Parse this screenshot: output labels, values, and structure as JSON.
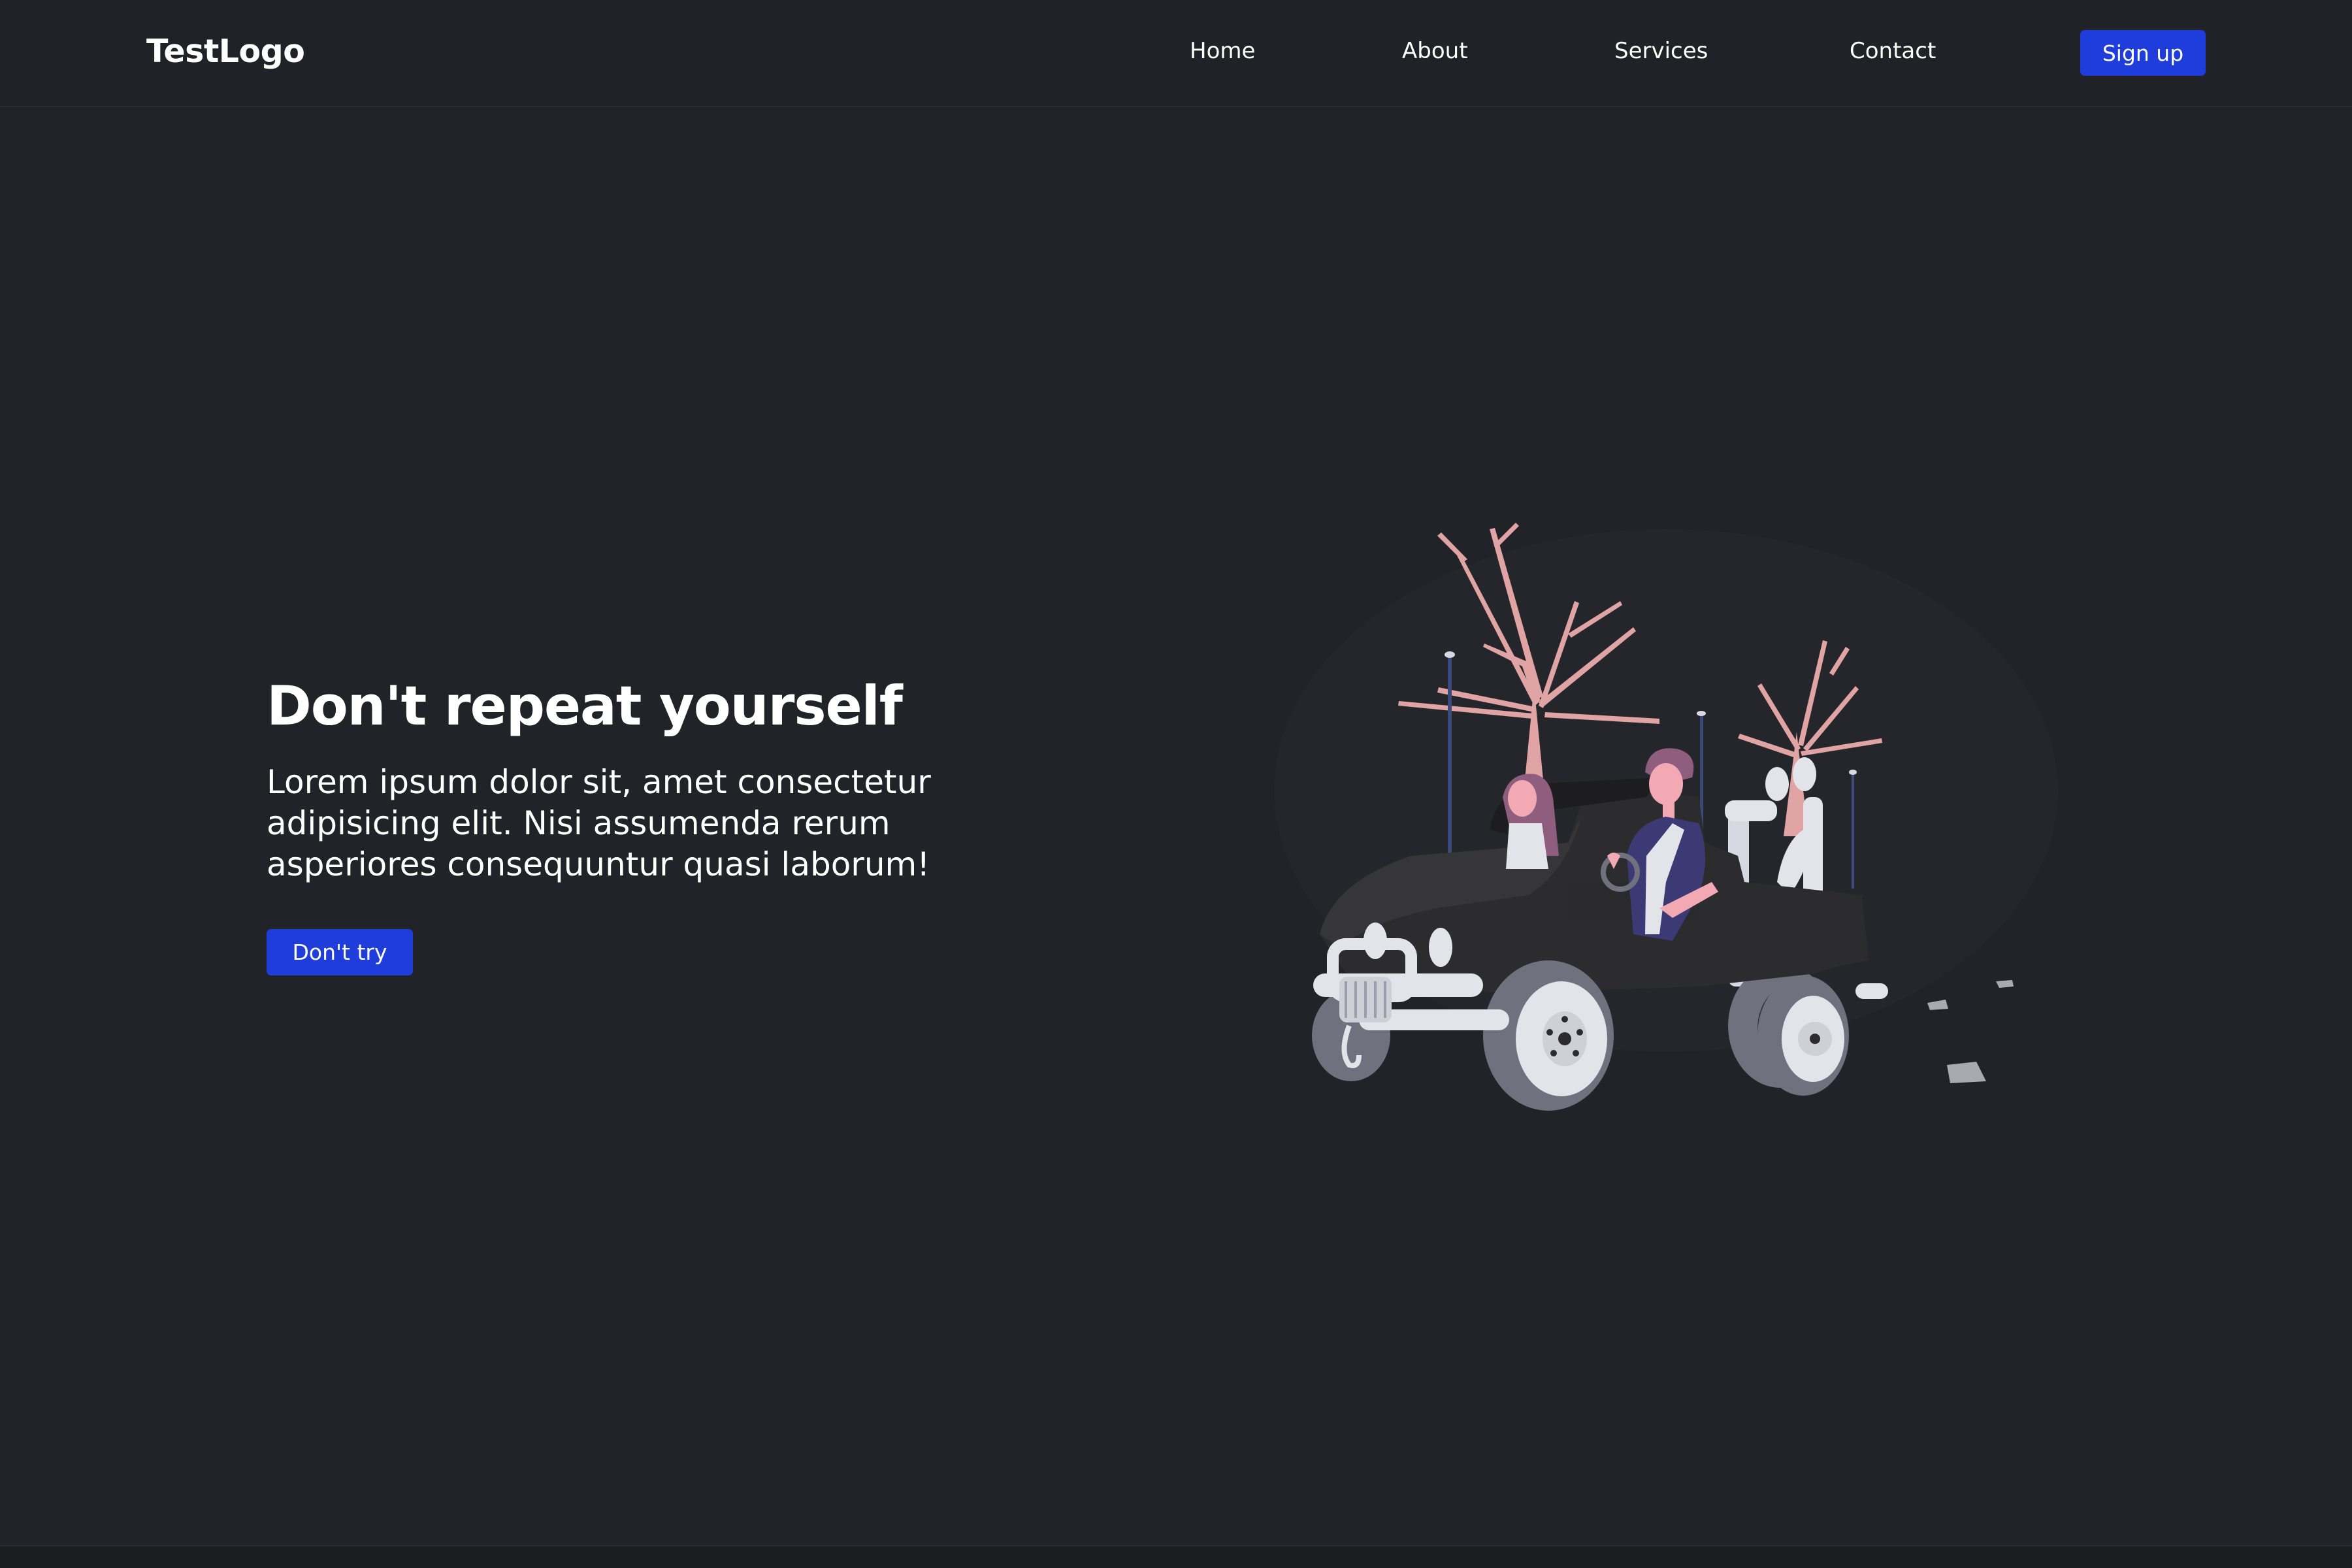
{
  "nav": {
    "logo": "TestLogo",
    "links": [
      "Home",
      "About",
      "Services",
      "Contact"
    ],
    "signup": "Sign up"
  },
  "hero": {
    "title": "Don't repeat yourself",
    "description_lines": [
      "Lorem ipsum dolor sit, amet consectetur",
      "adipisicing elit. Nisi assumenda rerum",
      "asperiores consequuntur quasi laborum!"
    ],
    "cta": "Don't try"
  },
  "colors": {
    "background": "#222328",
    "accent": "#1f3ddb",
    "tree": "#e0a4a4",
    "car_body": "#2c2c2e",
    "wheel": "#70707f",
    "metal": "#e3e3ea",
    "jacket": "#3b3a74",
    "hair": "#8f5e7f",
    "skin": "#f3a9b4"
  },
  "illustration": {
    "icon": "jeep-illustration"
  }
}
